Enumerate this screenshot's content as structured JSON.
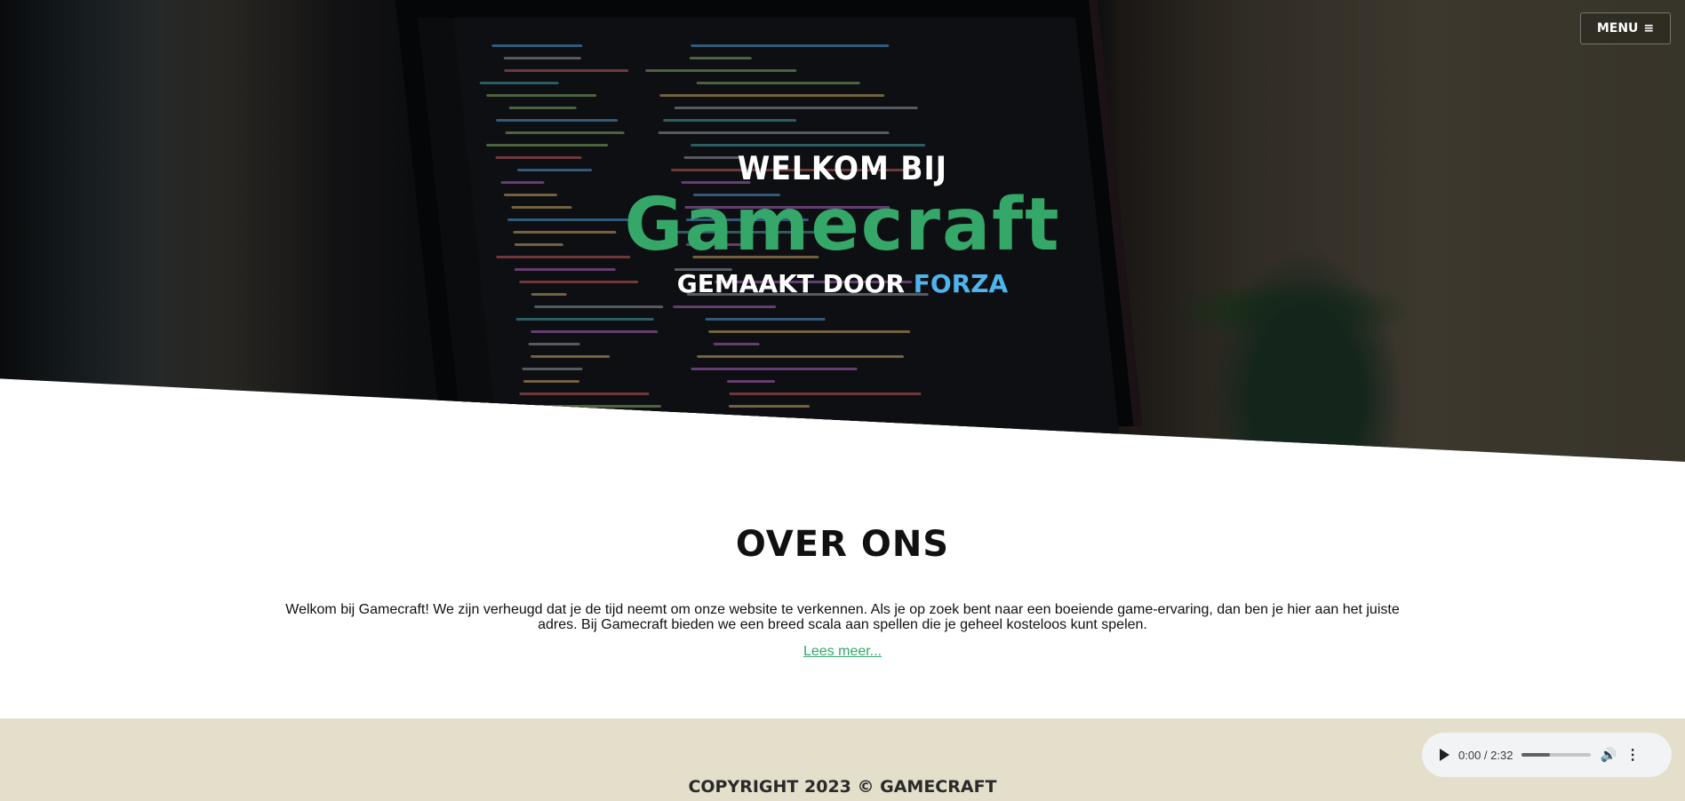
{
  "header": {
    "menu_label": "MENU",
    "menu_icon": "hamburger-icon"
  },
  "hero": {
    "line1": "Welkom bij",
    "title": "Gamecraft",
    "made_by": "Gemaakt door",
    "author": "Forza",
    "background_image": "laptop-code-screen-photo"
  },
  "about": {
    "title": "Over ons",
    "text": "Welkom bij Gamecraft! We zijn verheugd dat je de tijd neemt om onze website te verkennen. Als je op zoek bent naar een boeiende game-ervaring, dan ben je hier aan het juiste adres. Bij Gamecraft bieden we een breed scala aan spellen die je geheel kosteloos kunt spelen.",
    "read_more": "Lees meer..."
  },
  "footer": {
    "copyright": "Copyright 2023 © Gamecraft"
  },
  "audio": {
    "time": "0:00 / 2:32",
    "progress_fraction": 0.4,
    "play_icon": "play-icon",
    "volume_icon": "volume-icon",
    "more_icon": "more-options-icon"
  },
  "colors": {
    "accent_green": "#35a768",
    "accent_blue": "#4fb4ec",
    "footer_bg": "#e3dfca"
  }
}
